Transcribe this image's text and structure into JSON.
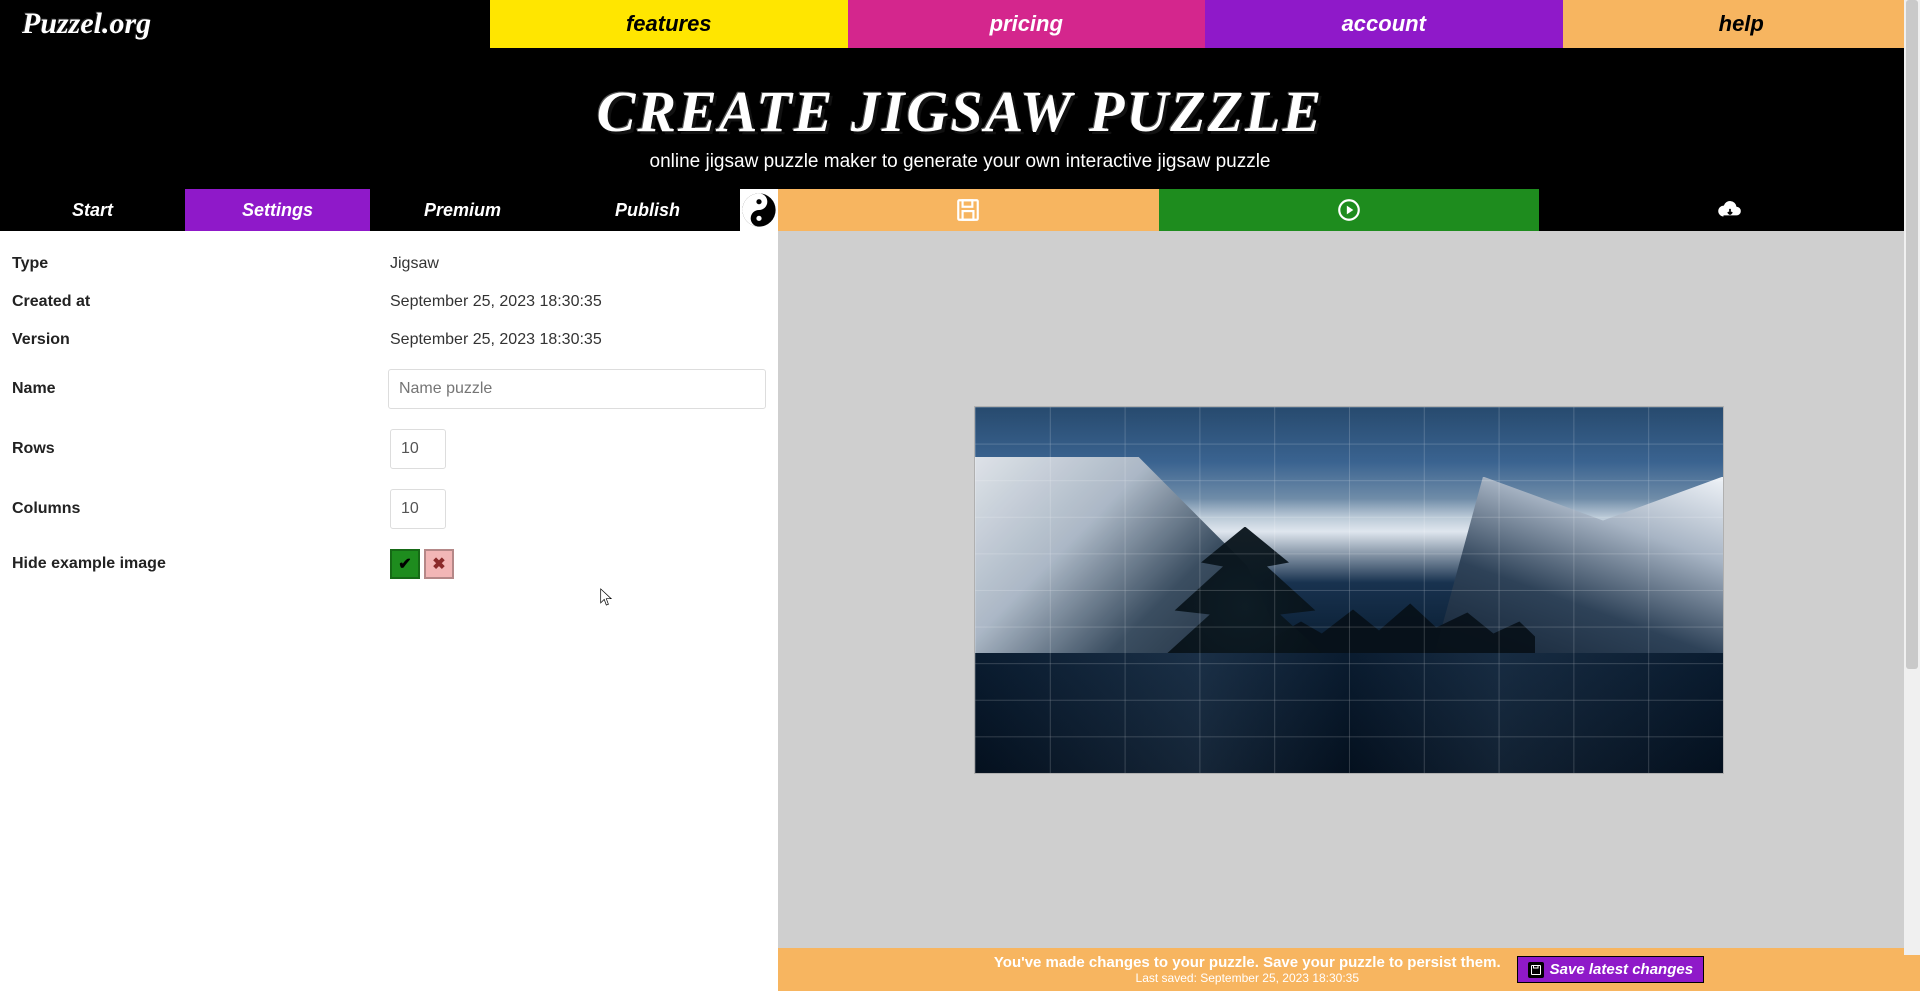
{
  "logo": "Puzzel.org",
  "nav": {
    "features": "features",
    "pricing": "pricing",
    "account": "account",
    "help": "help"
  },
  "hero": {
    "title": "CREATE JIGSAW PUZZLE",
    "subtitle": "online jigsaw puzzle maker to generate your own interactive jigsaw puzzle"
  },
  "tabs": {
    "start": "Start",
    "settings": "Settings",
    "premium": "Premium",
    "publish": "Publish"
  },
  "settings": {
    "type_label": "Type",
    "type_value": "Jigsaw",
    "created_label": "Created at",
    "created_value": "September 25, 2023 18:30:35",
    "version_label": "Version",
    "version_value": "September 25, 2023 18:30:35",
    "name_label": "Name",
    "name_placeholder": "Name puzzle",
    "name_value": "",
    "rows_label": "Rows",
    "rows_value": "10",
    "cols_label": "Columns",
    "cols_value": "10",
    "hide_label": "Hide example image",
    "yes_glyph": "✔",
    "no_glyph": "✖"
  },
  "savebar": {
    "message": "You've made changes to your puzzle. Save your puzzle to persist them.",
    "last_saved": "Last saved: September 25, 2023 18:30:35",
    "button": "Save latest changes"
  }
}
